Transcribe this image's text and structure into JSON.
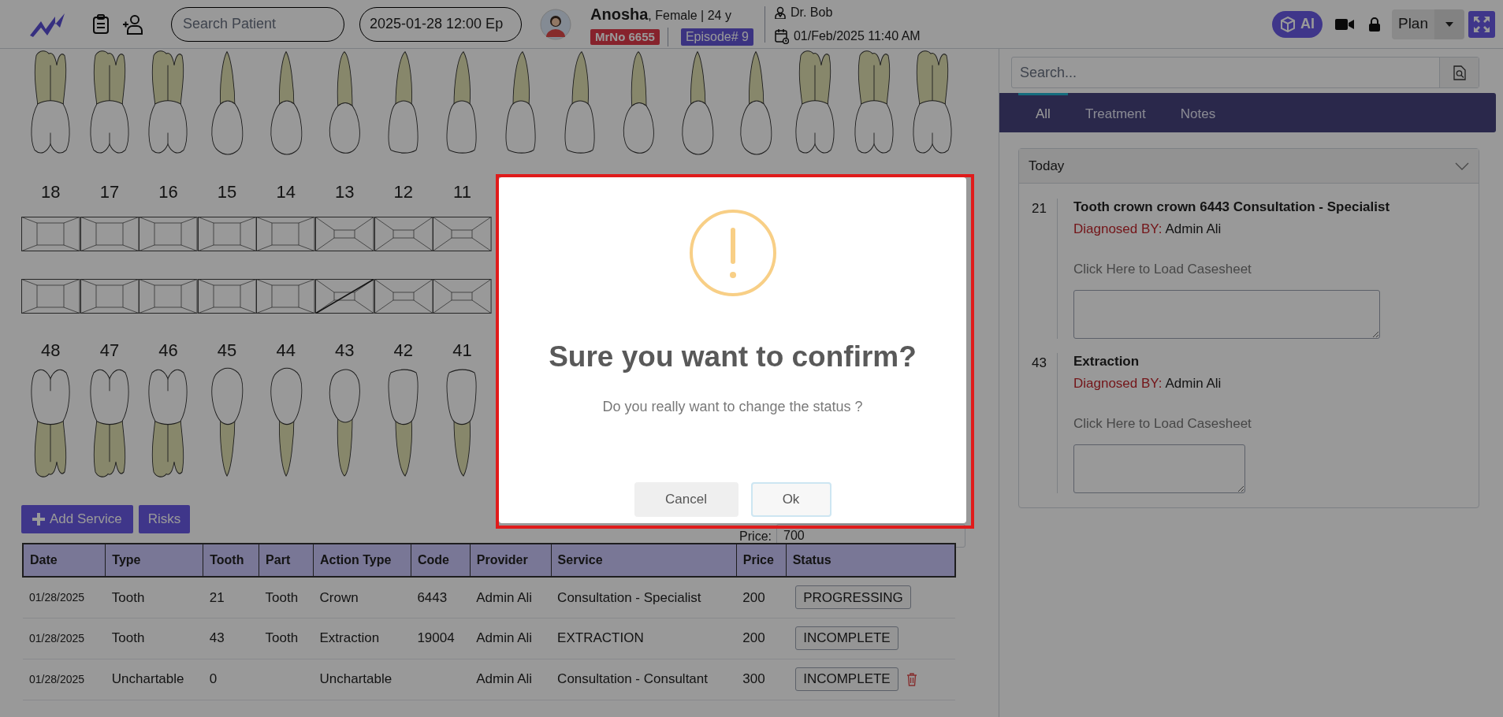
{
  "header": {
    "search": {
      "placeholder": "Search Patient"
    },
    "date_field": {
      "value": "2025-01-28 12:00 Ep"
    },
    "patient": {
      "name": "Anosha",
      "details": ", Female | 24 y",
      "mrno": "MrNo 6655",
      "episode": "Episode# 9"
    },
    "doctor": "Dr. Bob",
    "datetime": "01/Feb/2025 11:40 AM",
    "ai_button": "AI",
    "plan_button": "Plan"
  },
  "chart": {
    "upper_teeth": [
      {
        "number": "18",
        "kind": "molar",
        "marked": false
      },
      {
        "number": "17",
        "kind": "molar",
        "marked": false
      },
      {
        "number": "16",
        "kind": "molar",
        "marked": false
      },
      {
        "number": "15",
        "kind": "premolar",
        "marked": false
      },
      {
        "number": "14",
        "kind": "premolar",
        "marked": false
      },
      {
        "number": "13",
        "kind": "canine",
        "marked": false
      },
      {
        "number": "12",
        "kind": "incisor",
        "marked": false
      },
      {
        "number": "11",
        "kind": "incisor",
        "marked": false
      },
      {
        "kind": "incisor"
      },
      {
        "kind": "incisor"
      },
      {
        "kind": "canine"
      },
      {
        "kind": "premolar"
      },
      {
        "kind": "premolar"
      },
      {
        "kind": "molar"
      },
      {
        "kind": "molar"
      },
      {
        "kind": "molar"
      }
    ],
    "lower_teeth": [
      {
        "number": "48",
        "kind": "molar",
        "marked": false
      },
      {
        "number": "47",
        "kind": "molar",
        "marked": false
      },
      {
        "number": "46",
        "kind": "molar",
        "marked": false
      },
      {
        "number": "45",
        "kind": "premolar",
        "marked": false
      },
      {
        "number": "44",
        "kind": "premolar",
        "marked": false
      },
      {
        "number": "43",
        "kind": "canine",
        "marked": true
      },
      {
        "number": "42",
        "kind": "incisor",
        "marked": false
      },
      {
        "number": "41",
        "kind": "incisor",
        "marked": false
      }
    ]
  },
  "actions": {
    "add_service": "Add Service",
    "risks": "Risks",
    "price_label": "Price:",
    "price_value": "700"
  },
  "table": {
    "columns": [
      "Date",
      "Type",
      "Tooth",
      "Part",
      "Action Type",
      "Code",
      "Provider",
      "Service",
      "Price",
      "Status"
    ],
    "rows": [
      {
        "cells": [
          "01/28/2025",
          "Tooth",
          "21",
          "Tooth",
          "Crown",
          "6443",
          "Admin Ali",
          "Consultation - Specialist",
          "200"
        ],
        "status": "PROGRESSING",
        "deletable": false
      },
      {
        "cells": [
          "01/28/2025",
          "Tooth",
          "43",
          "Tooth",
          "Extraction",
          "19004",
          "Admin Ali",
          "EXTRACTION",
          "200"
        ],
        "status": "INCOMPLETE",
        "deletable": false
      },
      {
        "cells": [
          "01/28/2025",
          "Unchartable",
          "0",
          "",
          "Unchartable",
          "",
          "Admin Ali",
          "Consultation - Consultant",
          "300"
        ],
        "status": "INCOMPLETE",
        "deletable": true
      }
    ]
  },
  "sidebar": {
    "search_placeholder": "Search...",
    "tabs": [
      {
        "label": "All",
        "selected": true
      },
      {
        "label": "Treatment",
        "selected": false
      },
      {
        "label": "Notes",
        "selected": false
      }
    ],
    "group": {
      "title": "Today",
      "expanded": true
    },
    "entries": [
      {
        "tooth": "21",
        "title": "Tooth crown crown 6443 Consultation - Specialist",
        "label": "Diagnosed BY:",
        "by": "Admin Ali",
        "link": "Click Here to Load Casesheet",
        "kind": "wide"
      },
      {
        "tooth": "43",
        "title": "Extraction",
        "label": "Diagnosed BY:",
        "by": "Admin Ali",
        "link": "Click Here to Load Casesheet",
        "kind": "narrow"
      }
    ]
  },
  "dialog": {
    "title": "Sure you want to confirm?",
    "text": "Do you really want to change the status ?",
    "buttons": [
      {
        "label": "Cancel",
        "kind": "cancel"
      },
      {
        "label": "Ok",
        "kind": "confirm"
      }
    ],
    "highlighted": true
  }
}
